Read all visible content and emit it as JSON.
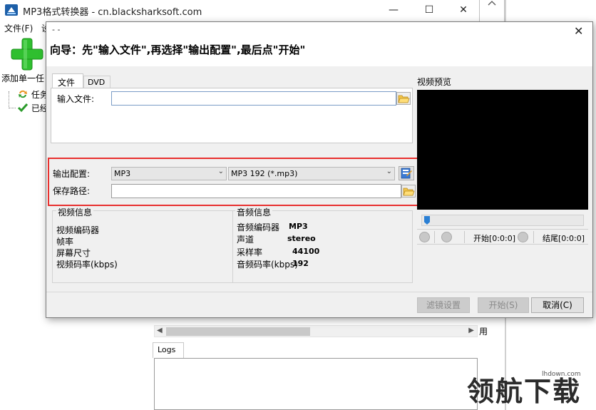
{
  "window": {
    "title": "MP3格式转换器 - cn.blacksharksoft.com",
    "controls": {
      "minimize": "—",
      "maximize": "☐",
      "close": "✕"
    }
  },
  "menu": {
    "items": [
      "文件(F)",
      "设"
    ]
  },
  "toolbar": {
    "add_label": "添加单一任"
  },
  "tree": {
    "items": [
      "任务",
      "已经"
    ]
  },
  "background": {
    "use_text": "用",
    "logs_tab": "Logs"
  },
  "dialog": {
    "title": "- -",
    "close": "✕",
    "guide": "向导：先\"输入文件\",再选择\"输出配置\",最后点\"开始\"",
    "tabs": [
      "文件",
      "DVD"
    ],
    "input_file_label": "输入文件:",
    "input_file_value": "",
    "output_config_label": "输出配置:",
    "output_format": "MP3",
    "output_profile": "MP3 192 (*.mp3)",
    "save_path_label": "保存路径:",
    "save_path_value": "",
    "video_info": {
      "title": "视频信息",
      "rows": [
        "视频编码器",
        "帧率",
        "屏幕尺寸",
        "视频码率(kbps)"
      ]
    },
    "audio_info": {
      "title": "音频信息",
      "rows": [
        {
          "label": "音频编码器",
          "value": "MP3"
        },
        {
          "label": "声道",
          "value": "stereo"
        },
        {
          "label": "采样率",
          "value": "44100"
        },
        {
          "label": "音频码率(kbps)",
          "value": "192"
        }
      ]
    },
    "preview_label": "视频预览",
    "start_time": "开始[0:0:0]",
    "end_time": "结尾[0:0:0]",
    "buttons": {
      "filter": "滤镜设置",
      "start": "开始(S)",
      "cancel": "取消(C)"
    }
  },
  "watermark": {
    "text": "领航下载",
    "sub": "lhdown.com"
  },
  "colors": {
    "highlight_box": "#e8302e",
    "preview_bg": "#000000",
    "add_icon": "#2fbf2f"
  }
}
